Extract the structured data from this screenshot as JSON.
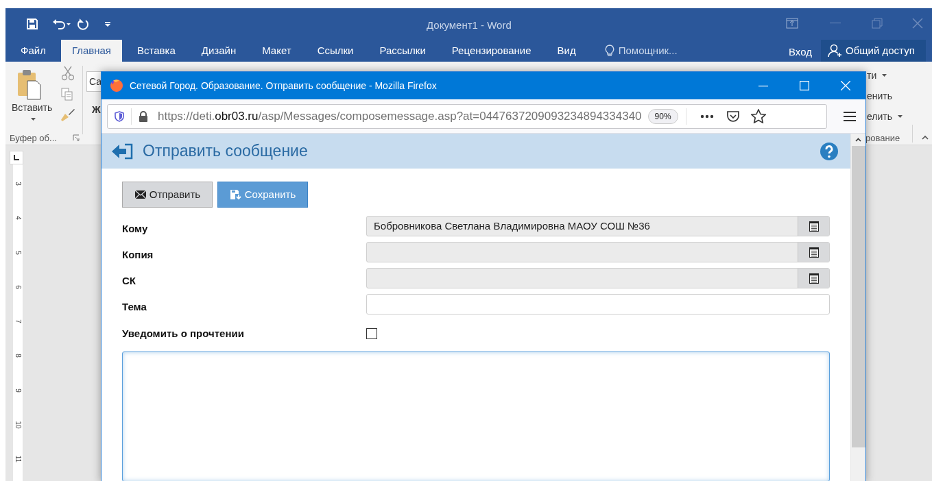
{
  "word": {
    "title": "Документ1 - Word",
    "tabs": [
      {
        "label": "Файл",
        "selected": false
      },
      {
        "label": "Главная",
        "selected": true
      },
      {
        "label": "Вставка",
        "selected": false
      },
      {
        "label": "Дизайн",
        "selected": false
      },
      {
        "label": "Макет",
        "selected": false
      },
      {
        "label": "Ссылки",
        "selected": false
      },
      {
        "label": "Рассылки",
        "selected": false
      },
      {
        "label": "Рецензирование",
        "selected": false
      },
      {
        "label": "Вид",
        "selected": false
      }
    ],
    "tell_me": "Помощник...",
    "sign_in": "Вход",
    "share": "Общий доступ",
    "ribbon": {
      "paste_label": "Вставить",
      "clipboard_group": "Буфер об...",
      "font_box": "Са",
      "bold_fragment": "Ж",
      "right_fragments": [
        {
          "text": "ти",
          "caret": true
        },
        {
          "text": "енить",
          "caret": false
        },
        {
          "text": "елить",
          "caret": true
        }
      ],
      "right_group": "рование"
    },
    "ruler_numbers": [
      "3",
      "4",
      "5",
      "6",
      "7",
      "8",
      "9",
      "10",
      "11"
    ]
  },
  "firefox": {
    "title": "Сетевой Город. Образование. Отправить сообщение - Mozilla Firefox",
    "url": {
      "prefix": "https://deti.",
      "domain": "obr03.ru",
      "path": "/asp/Messages/composemessage.asp?at=0447637209093234894334340"
    },
    "zoom": "90%",
    "page": {
      "heading": "Отправить сообщение",
      "buttons": [
        {
          "label": "Отправить",
          "kind": "send",
          "primary": false
        },
        {
          "label": "Сохранить",
          "kind": "save",
          "primary": true
        }
      ],
      "fields": [
        {
          "label": "Кому",
          "kind": "address",
          "value": "Бобровникова Светлана Владимировна МАОУ СОШ №36"
        },
        {
          "label": "Копия",
          "kind": "address"
        },
        {
          "label": "СК",
          "kind": "address"
        },
        {
          "label": "Тема",
          "kind": "text"
        }
      ],
      "read_receipt": {
        "label": "Уведомить о прочтении",
        "checked": false
      }
    }
  }
}
